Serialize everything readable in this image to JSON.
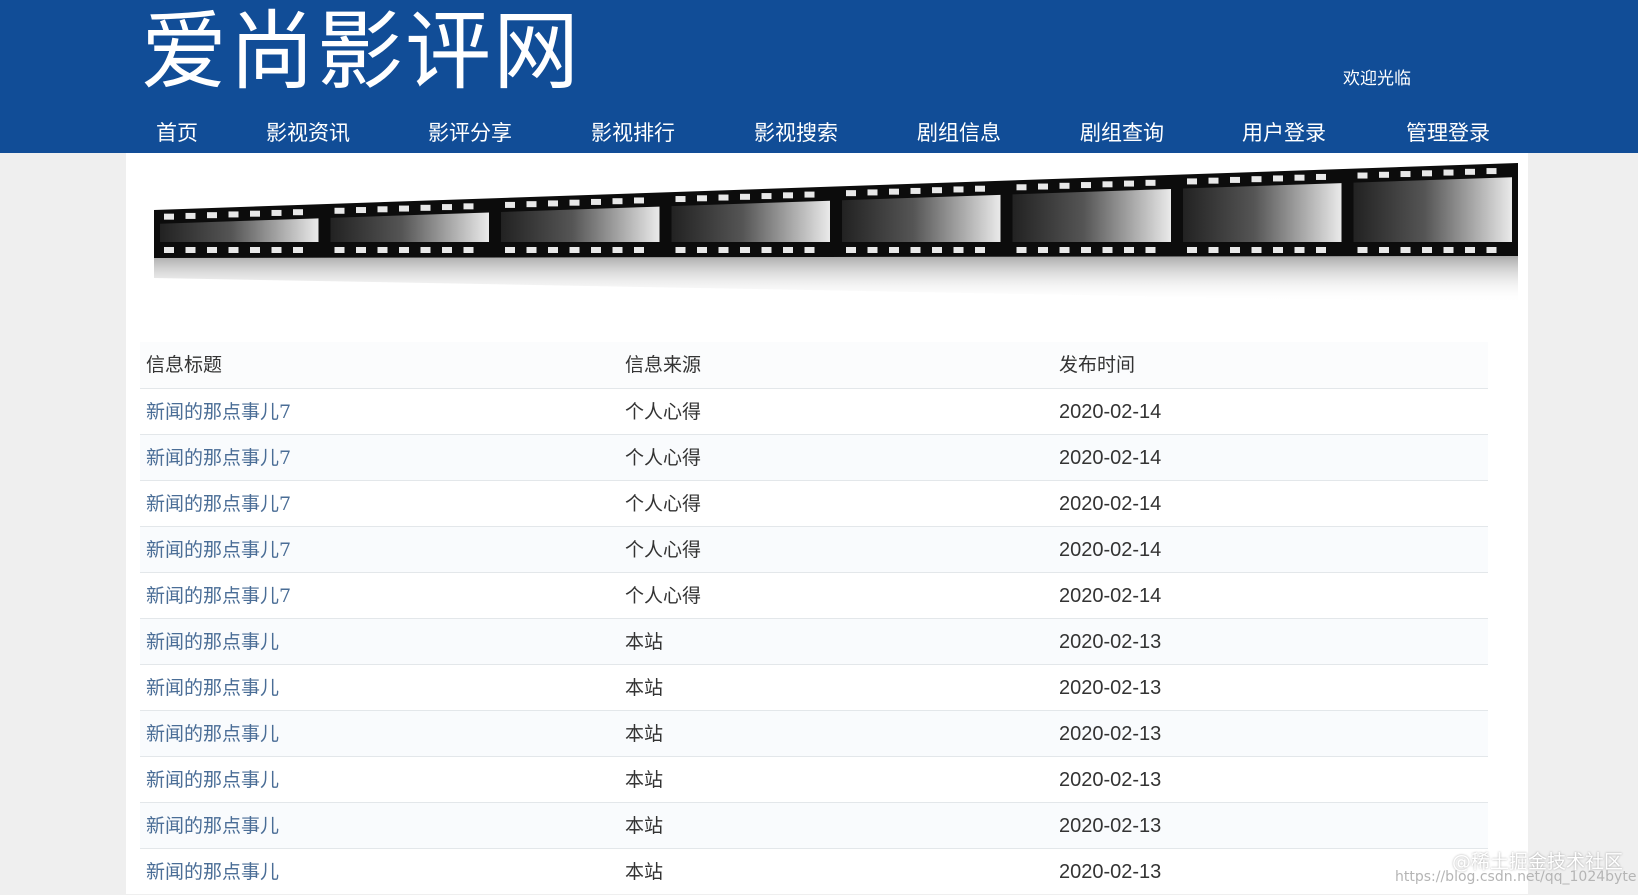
{
  "header": {
    "site_title": "爱尚影评网",
    "welcome_text": "欢迎光临",
    "nav": [
      "首页",
      "影视资讯",
      "影评分享",
      "影视排行",
      "影视搜索",
      "剧组信息",
      "剧组查询",
      "用户登录",
      "管理登录"
    ]
  },
  "table": {
    "columns": [
      "信息标题",
      "信息来源",
      "发布时间"
    ],
    "rows": [
      [
        "新闻的那点事儿7",
        "个人心得",
        "2020-02-14"
      ],
      [
        "新闻的那点事儿7",
        "个人心得",
        "2020-02-14"
      ],
      [
        "新闻的那点事儿7",
        "个人心得",
        "2020-02-14"
      ],
      [
        "新闻的那点事儿7",
        "个人心得",
        "2020-02-14"
      ],
      [
        "新闻的那点事儿7",
        "个人心得",
        "2020-02-14"
      ],
      [
        "新闻的那点事儿",
        "本站",
        "2020-02-13"
      ],
      [
        "新闻的那点事儿",
        "本站",
        "2020-02-13"
      ],
      [
        "新闻的那点事儿",
        "本站",
        "2020-02-13"
      ],
      [
        "新闻的那点事儿",
        "本站",
        "2020-02-13"
      ],
      [
        "新闻的那点事儿",
        "本站",
        "2020-02-13"
      ],
      [
        "新闻的那点事儿",
        "本站",
        "2020-02-13"
      ]
    ]
  },
  "watermark": {
    "brand": "@稀土掘金技术社区",
    "url": "https://blog.csdn.net/qq_1024byte"
  },
  "colors": {
    "header_bg": "#114d97",
    "link": "#4a6d96",
    "page_bg": "#efefef"
  }
}
